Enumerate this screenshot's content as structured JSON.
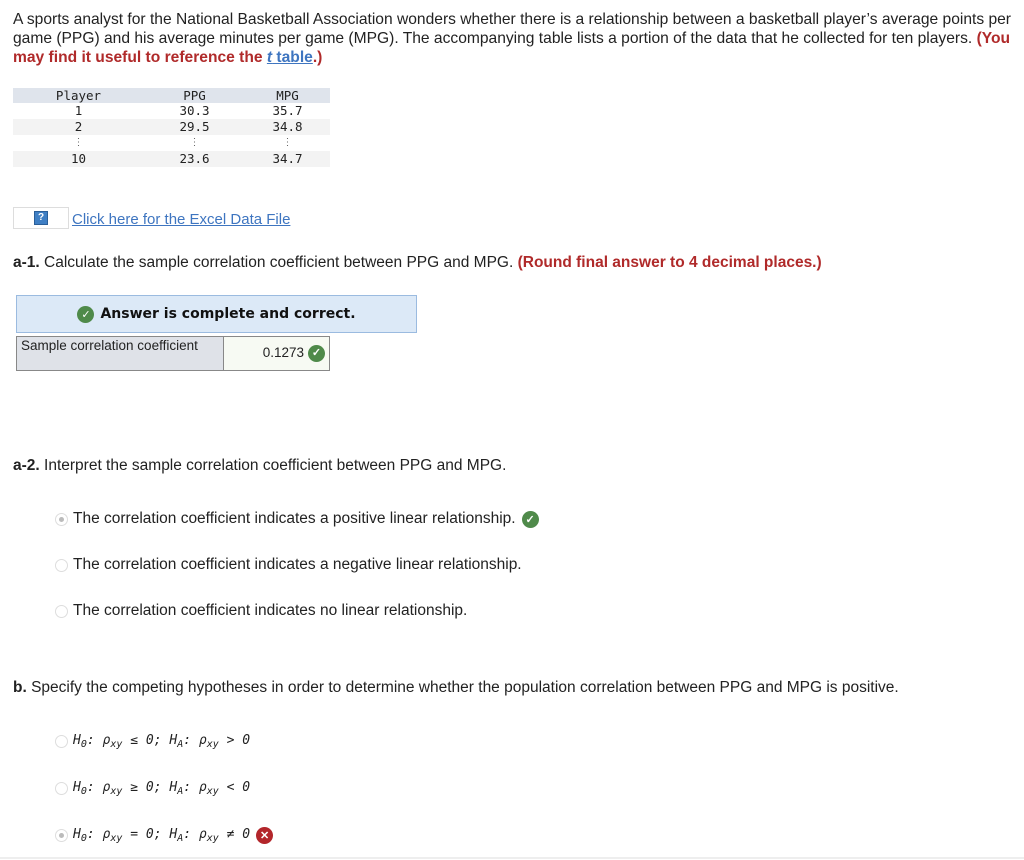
{
  "intro": {
    "text": "A sports analyst for the National Basketball Association wonders whether there is a relationship between a basketball player’s average points per game (PPG) and his average minutes per game (MPG). The accompanying table lists a portion of the data that he collected for ten players.",
    "hint_prefix": "(You may find it useful to reference the ",
    "hint_link_italic": "t",
    "hint_link_text": " table",
    "hint_suffix": ".)"
  },
  "data_table": {
    "headers": [
      "Player",
      "PPG",
      "MPG"
    ],
    "rows": [
      [
        "1",
        "30.3",
        "35.7"
      ],
      [
        "2",
        "29.5",
        "34.8"
      ],
      [
        "⋮",
        "⋮",
        "⋮"
      ],
      [
        "10",
        "23.6",
        "34.7"
      ]
    ]
  },
  "excel": {
    "help_icon": "?",
    "link_text": "Click here for the Excel Data File"
  },
  "a1": {
    "label": "a-1.",
    "text": " Calculate the sample correlation coefficient between PPG and MPG. ",
    "hint": "(Round final answer to 4 decimal places.)",
    "banner": "Answer is complete and correct.",
    "field_label": "Sample correlation coefficient",
    "field_value": "0.1273",
    "status": "correct"
  },
  "a2": {
    "label": "a-2.",
    "text": " Interpret the sample correlation coefficient between PPG and MPG.",
    "options": [
      {
        "text": "The correlation coefficient indicates a positive linear relationship.",
        "selected": true,
        "status": "correct"
      },
      {
        "text": "The correlation coefficient indicates a negative linear relationship.",
        "selected": false,
        "status": ""
      },
      {
        "text": "The correlation coefficient indicates no linear relationship.",
        "selected": false,
        "status": ""
      }
    ]
  },
  "b": {
    "label": "b.",
    "text": " Specify the competing hypotheses in order to determine whether the population correlation between PPG and MPG is positive.",
    "options": [
      {
        "h0": "H",
        "h0_sub": "0",
        "rel0": ": ρ",
        "xy": "xy",
        "op0": " ≤ 0; ",
        "ha": "H",
        "ha_sub": "A",
        "rel1": ": ρ",
        "op1": " > 0",
        "selected": false,
        "status": ""
      },
      {
        "h0": "H",
        "h0_sub": "0",
        "rel0": ": ρ",
        "xy": "xy",
        "op0": " ≥ 0; ",
        "ha": "H",
        "ha_sub": "A",
        "rel1": ": ρ",
        "op1": " < 0",
        "selected": false,
        "status": ""
      },
      {
        "h0": "H",
        "h0_sub": "0",
        "rel0": ": ρ",
        "xy": "xy",
        "op0": " = 0; ",
        "ha": "H",
        "ha_sub": "A",
        "rel1": ": ρ",
        "op1": " ≠ 0",
        "selected": true,
        "status": "incorrect"
      }
    ]
  },
  "icons": {
    "check": "✓",
    "cross": "✕"
  },
  "colors": {
    "hint_red": "#b02a2a",
    "link_blue": "#3e75c0",
    "correct_green": "#4f8a4a",
    "incorrect_red": "#b3262b",
    "banner_bg": "#dce9f7"
  }
}
